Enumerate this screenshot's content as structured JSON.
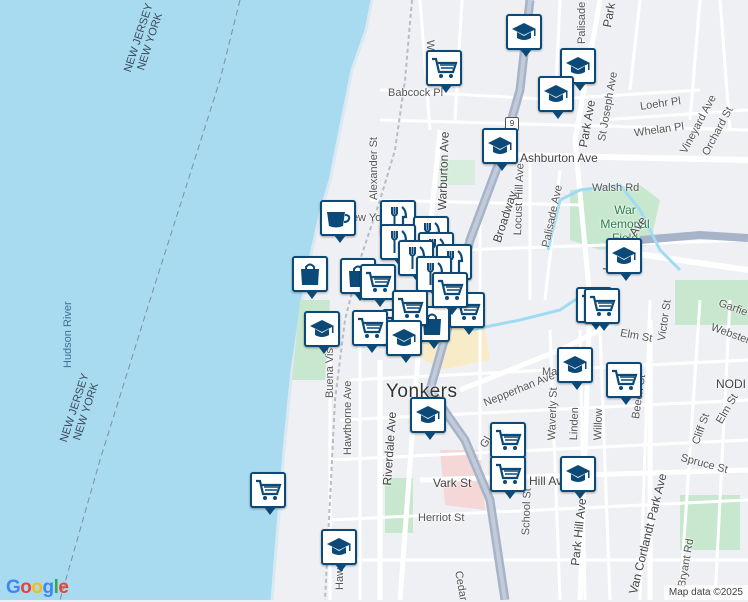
{
  "map": {
    "city_label": "Yonkers",
    "river_label": "Hudson River",
    "state_border_labels": [
      {
        "top": "NEW JERSEY",
        "bottom": "NEW YORK"
      },
      {
        "top": "NEW JERSEY",
        "bottom": "NEW YORK"
      }
    ],
    "neighborhood_label": "NODI",
    "park_label": "War Memorial Field",
    "route_shield": "9",
    "street_labels": {
      "woodworth": "Woodw",
      "palisade_top": "Palisade",
      "park_ave_top": "Park",
      "babcock": "Babcock Pl",
      "loehr": "Loehr Pl",
      "st_joseph": "St Joseph Ave",
      "whelan": "Whelan Pl",
      "vineyard": "Vineyard Ave",
      "orchard": "Orchard St",
      "ashburton": "Ashburton Ave",
      "park_ave_mid": "Park Ave",
      "alexander": "Alexander St",
      "warburton": "Warburton Ave",
      "broadway": "Broadway",
      "locust_hill": "Locust Hill Ave",
      "palisade_mid": "Palisade Ave",
      "walsh": "Walsh Rd",
      "yonkers_ave": "Yonkers Ave",
      "garfield": "Garfie",
      "webster": "Webster",
      "elm_mid": "Elm St",
      "victor": "Victor St",
      "nepperhan": "Nepperhan Ave",
      "main": "Ma",
      "buena_vista": "Buena Vista Ave",
      "hawthorne": "Hawthorne Ave",
      "riverdale": "Riverdale Ave",
      "waverly": "Waverly St",
      "linden": "Linden",
      "willow": "Willow",
      "beech": "Beech St",
      "elm_right": "Elm St",
      "cliff": "Cliff St",
      "spruce": "Spruce St",
      "vark": "Vark St",
      "hill": "Hill Ave",
      "school": "School St",
      "park_hill": "Park Hill Ave",
      "van_cortlandt": "Van Cortlandt Park Ave",
      "herriot": "Herriot St",
      "haw_bottom": "Haw",
      "cedar": "Cedar",
      "bryant": "Bryant Rd",
      "glen": "Gl",
      "station_label": "New York"
    }
  },
  "icons": {
    "school": "graduation-cap-icon",
    "store": "shopping-cart-icon",
    "shop": "shopping-bag-icon",
    "restaurant": "fork-knife-icon",
    "cafe": "coffee-cup-icon"
  },
  "colors": {
    "water": "#a8daf0",
    "land": "#eef0f4",
    "park": "#c7e8cf",
    "highway": "#a6b3c8",
    "downtown": "#f8ecc8",
    "marker_border": "#0b4a78",
    "route_blue": "#9fdcf3"
  },
  "markers": [
    {
      "type": "school"
    },
    {
      "type": "school"
    },
    {
      "type": "school"
    },
    {
      "type": "school"
    },
    {
      "type": "store"
    },
    {
      "type": "store"
    },
    {
      "type": "store"
    },
    {
      "type": "store"
    },
    {
      "type": "store"
    },
    {
      "type": "store"
    },
    {
      "type": "store"
    },
    {
      "type": "store"
    },
    {
      "type": "school"
    },
    {
      "type": "school"
    },
    {
      "type": "school"
    },
    {
      "type": "school"
    },
    {
      "type": "school"
    },
    {
      "type": "school"
    },
    {
      "type": "store"
    },
    {
      "type": "cafe"
    },
    {
      "type": "restaurant"
    },
    {
      "type": "restaurant"
    },
    {
      "type": "restaurant"
    },
    {
      "type": "restaurant"
    },
    {
      "type": "restaurant"
    },
    {
      "type": "restaurant"
    },
    {
      "type": "restaurant"
    },
    {
      "type": "shop"
    },
    {
      "type": "shop"
    },
    {
      "type": "shop"
    },
    {
      "type": "store"
    },
    {
      "type": "store"
    },
    {
      "type": "store"
    },
    {
      "type": "store"
    },
    {
      "type": "school"
    }
  ],
  "attribution": "Map data ©2025",
  "google_logo": "Google"
}
